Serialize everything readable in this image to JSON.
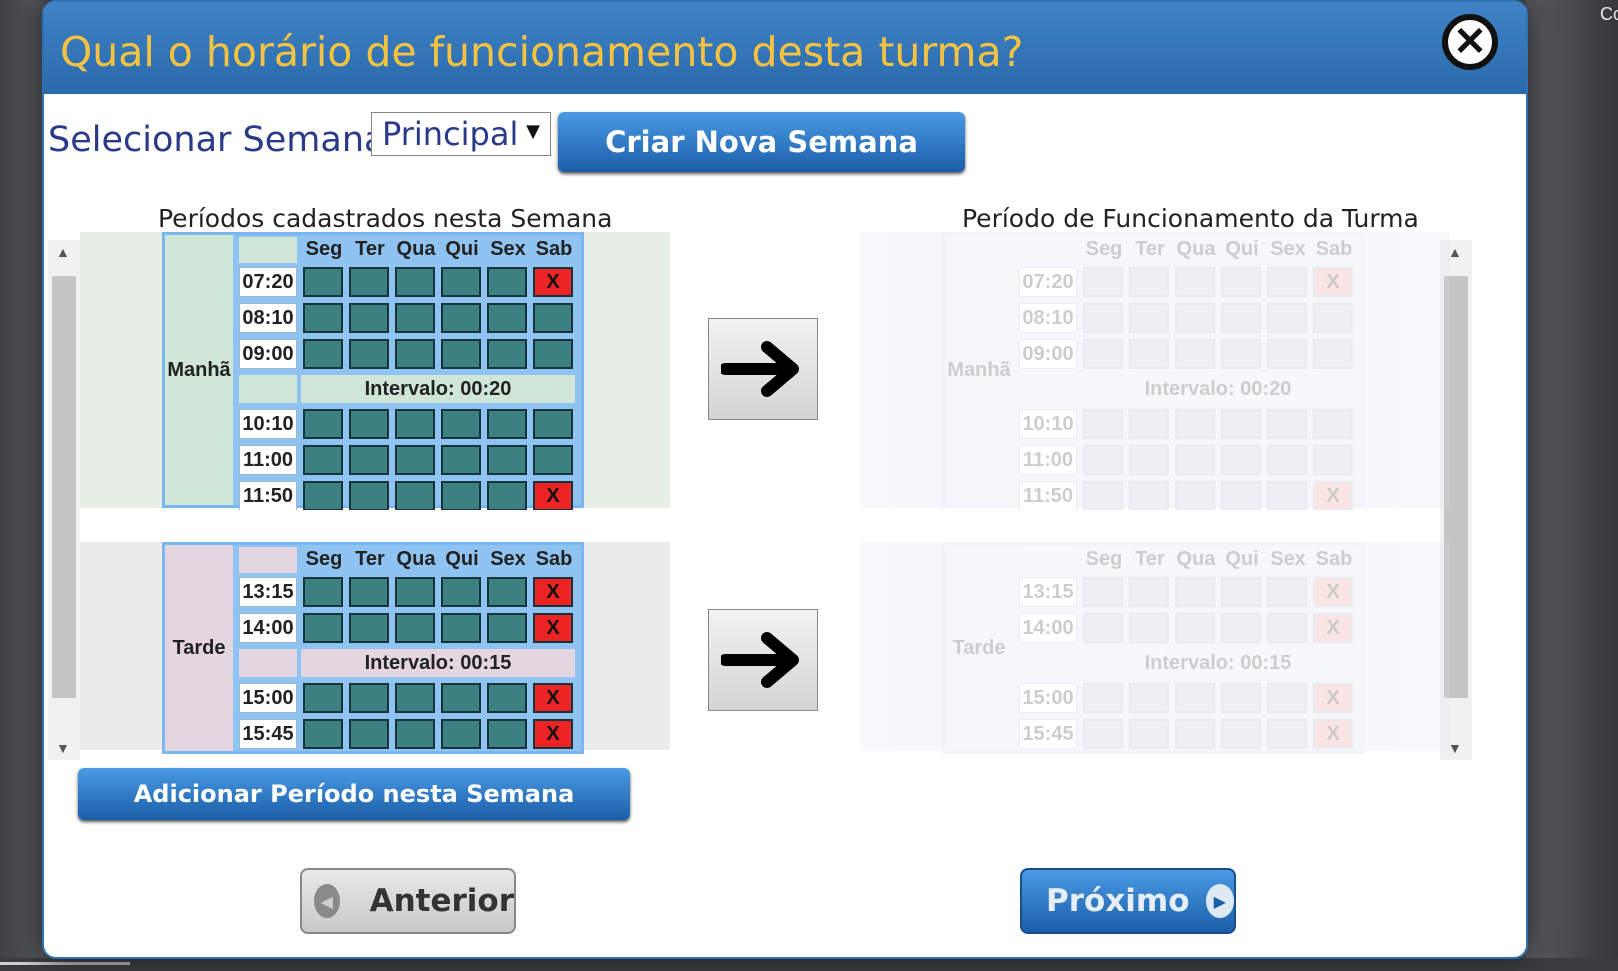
{
  "background_text": "Co",
  "dialog": {
    "title": "Qual o horário de funcionamento desta turma?",
    "close_label": "✕",
    "select_week_label": "Selecionar Semana:",
    "select_week_value": "Principal",
    "select_week_chevron": "▼",
    "create_week_button": "Criar Nova Semana",
    "left_column_title": "Períodos cadastrados nesta Semana",
    "right_column_title": "Período de Funcionamento da Turma",
    "add_period_button": "Adicionar Período nesta Semana",
    "previous_button": "Anterior",
    "next_button": "Próximo",
    "scroll_up": "▲",
    "scroll_down": "▼"
  },
  "days": [
    "Seg",
    "Ter",
    "Qua",
    "Qui",
    "Sex",
    "Sab"
  ],
  "periods": [
    {
      "name": "Manhã",
      "times_before": [
        "07:20",
        "08:10",
        "09:00"
      ],
      "interval": "Intervalo: 00:20",
      "times_after": [
        "10:10",
        "11:00",
        "11:50"
      ],
      "blocked_label": "X"
    },
    {
      "name": "Tarde",
      "times_before": [
        "13:15",
        "14:00"
      ],
      "interval": "Intervalo: 00:15",
      "times_after": [
        "15:00",
        "15:45"
      ],
      "blocked_label": "X"
    }
  ],
  "colors": {
    "title_text": "#f6c341",
    "title_bar": "#2f71b5",
    "slot": "#3d8082",
    "blocked": "#ec2424"
  }
}
